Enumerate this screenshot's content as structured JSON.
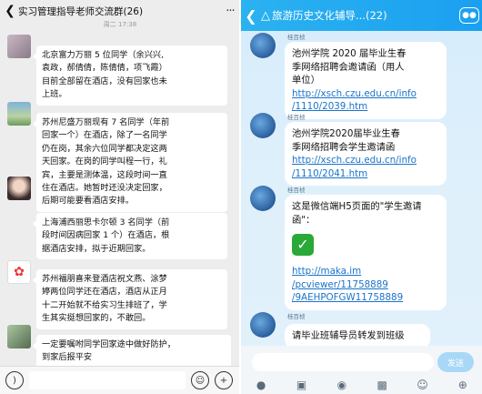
{
  "left": {
    "title": "实习管理指导老师交流群(26)",
    "time": "周二 17:38",
    "messages": [
      {
        "text_lines": [
          "北京富力万丽 5 位同学（余兴兴,",
          "袁政，郝倩倩，陈倩倩，项飞霞）",
          "目前全部留在酒店，没有回家也未",
          "上班。"
        ]
      },
      {
        "text_lines": [
          "苏州尼盛万丽现有 7 名同学（年前",
          "回家一个）在酒店，除了一名同学",
          "仍在岗，其余六位同学都决定这两",
          "天回家。在岗的同学叫程一行，礼",
          "宾，主要是测体温，这段时间一直",
          "住在酒店。她暂时还没决定回家，",
          "后期可能要看酒店安排。"
        ]
      },
      {
        "text_lines": [
          "上海浦西丽思卡尔顿 3 名同学（前",
          "段时间因病回家 1 个）在酒店，根",
          "据酒店安排，拟于近期回家。"
        ]
      },
      {
        "text_lines": [
          "苏州福朋喜来登酒店祝文燕、涂梦",
          "婷两位同学还在酒店，酒店从正月",
          "十二开始就不给实习生排班了，学",
          "生其实挺想回家的，不敢回。"
        ]
      },
      {
        "text_lines": [
          "一定要嘱咐同学回家途中做好防护，",
          "到家后报平安"
        ]
      }
    ]
  },
  "right": {
    "title": "旅游历史文化辅导...(22)",
    "messages": [
      {
        "name": "桂百桢",
        "lines": [
          "池州学院 2020 届毕业生春",
          "季网络招聘会邀请函（用人",
          "单位）"
        ],
        "link_lines": [
          "http://xsch.czu.edu.cn/info",
          "/1110/2039.htm"
        ]
      },
      {
        "name": "桂百桢",
        "lines": [
          "池州学院2020届毕业生春",
          "季网络招聘会学生邀请函"
        ],
        "link_lines": [
          "http://xsch.czu.edu.cn/info",
          "/1110/2041.htm"
        ]
      },
      {
        "name": "桂百桢",
        "lines": [
          "这是微信端H5页面的\"学生邀请",
          "函\"："
        ],
        "link_lines": [
          "http://maka.im",
          "/pcviewer/11758889",
          "/9AEHPOFGW11758889"
        ]
      },
      {
        "name": "桂百桢",
        "lines": [
          "请毕业班辅导员转发到班级"
        ]
      }
    ],
    "send_label": "发送"
  },
  "colors": {
    "qq_blue": "#1aa0f0",
    "link": "#1a73c9",
    "wechat_bg": "#ededed"
  }
}
